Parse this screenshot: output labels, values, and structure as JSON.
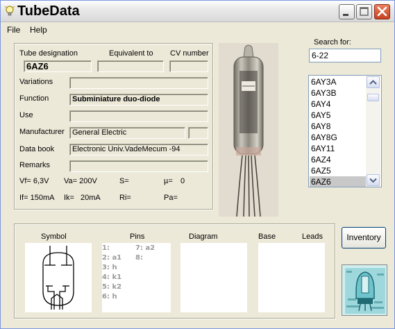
{
  "window": {
    "title": "TubeData"
  },
  "menu": {
    "file": "File",
    "help": "Help"
  },
  "tube": {
    "designation_label": "Tube designation",
    "designation": "6AZ6",
    "equivalent_label": "Equivalent to",
    "equivalent": "",
    "cv_label": "CV number",
    "cv": "",
    "variations_label": "Variations",
    "variations": "",
    "function_label": "Function",
    "function": "Subminiature duo-diode",
    "use_label": "Use",
    "use": "",
    "manufacturer_label": "Manufacturer",
    "manufacturer": "General Electric",
    "manufacturer_extra": "",
    "databook_label": "Data book",
    "databook": "Electronic Univ.VadeMecum -94",
    "remarks_label": "Remarks",
    "remarks": ""
  },
  "params": {
    "vf": "Vf= 6,3V",
    "va": "Va= 200V",
    "s": "S=",
    "mu": "µ=",
    "mu_val": "0",
    "if": "If= 150mA",
    "ik": "Ik=",
    "ik_val": "20mA",
    "ri": "Ri=",
    "pa": "Pa="
  },
  "search": {
    "label": "Search for:",
    "value": "6-22"
  },
  "list": {
    "items": [
      "6AY3A",
      "6AY3B",
      "6AY4",
      "6AY5",
      "6AY8",
      "6AY8G",
      "6AY11",
      "6AZ4",
      "6AZ5",
      "6AZ6"
    ],
    "selected": "6AZ6"
  },
  "bottom": {
    "symbol": "Symbol",
    "pins": "Pins",
    "diagram": "Diagram",
    "base": "Base",
    "leads": "Leads",
    "pin_list": [
      "1:",
      "2: a1",
      "3: h",
      "4: k1",
      "5: k2",
      "6: h",
      "7: a2",
      "8:"
    ]
  },
  "inventory": "Inventory",
  "colors": {
    "selection": "#c8c8c8",
    "close_button": "#d9542f",
    "panel": "#ece9d8"
  }
}
